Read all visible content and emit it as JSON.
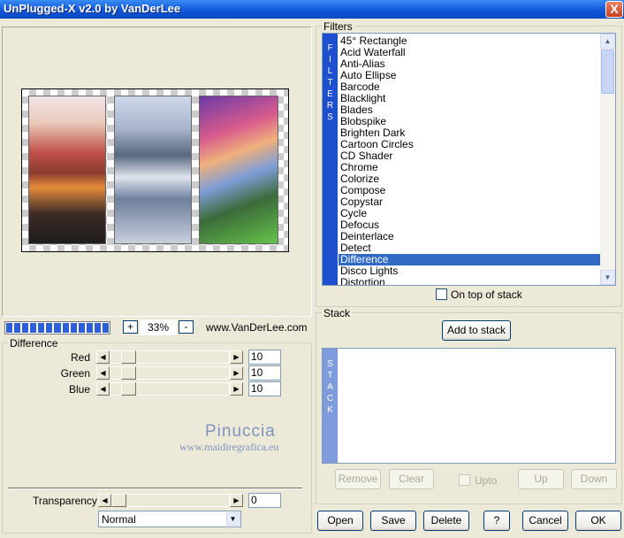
{
  "window": {
    "title": "UnPlugged-X v2.0 by VanDerLee",
    "close_glyph": "X"
  },
  "preview": {
    "zoom_minus": "-",
    "zoom_plus": "+",
    "zoom_value": "33%",
    "website": "www.VanDerLee.com",
    "progress_fraction": 1.0
  },
  "difference": {
    "group_label": "Difference",
    "sliders": [
      {
        "label": "Red",
        "value": "10",
        "level": 0.1
      },
      {
        "label": "Green",
        "value": "10",
        "level": 0.1
      },
      {
        "label": "Blue",
        "value": "10",
        "level": 0.1
      }
    ],
    "transparency": {
      "label": "Transparency",
      "value": "0",
      "level": 0.0
    },
    "blend_mode": "Normal"
  },
  "watermark": {
    "line1": "Pinuccia",
    "line2": "www.maidiregrafica.eu"
  },
  "filters": {
    "group_label": "Filters",
    "vertical_label": "FILTERS",
    "items": [
      "45° Rectangle",
      "Acid Waterfall",
      "Anti-Alias",
      "Auto Ellipse",
      "Barcode",
      "Blacklight",
      "Blades",
      "Blobspike",
      "Brighten Dark",
      "Cartoon Circles",
      "CD Shader",
      "Chrome",
      "Colorize",
      "Compose",
      "Copystar",
      "Cycle",
      "Defocus",
      "Deinterlace",
      "Detect",
      "Difference",
      "Disco Lights",
      "Distortion"
    ],
    "selected": "Difference",
    "on_top_label": "On top of stack",
    "on_top_checked": false
  },
  "stack": {
    "group_label": "Stack",
    "vertical_label": "STACK",
    "add_button": "Add to stack",
    "remove": "Remove",
    "clear": "Clear",
    "upto": "Upto",
    "up": "Up",
    "down": "Down"
  },
  "buttons": {
    "open": "Open",
    "save": "Save",
    "delete": "Delete",
    "help": "?",
    "cancel": "Cancel",
    "ok": "OK"
  },
  "colors": {
    "selection": "#316ac5",
    "filters_bar": "#1d4fcf",
    "stack_bar": "#7e9bdb",
    "titlebar": "#0b49c4"
  }
}
